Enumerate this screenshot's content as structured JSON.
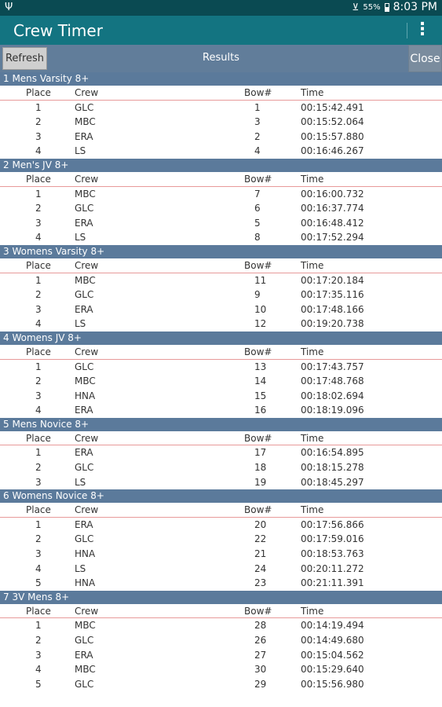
{
  "status_bar": {
    "battery_pct": "55%",
    "time": "8:03 PM"
  },
  "action_bar": {
    "title": "Crew Timer"
  },
  "toolbar": {
    "refresh_label": "Refresh",
    "heading": "Results",
    "close_label": "Close"
  },
  "columns": {
    "place": "Place",
    "crew": "Crew",
    "bow": "Bow#",
    "time": "Time"
  },
  "events": [
    {
      "name": "1 Mens Varsity 8+",
      "rows": [
        {
          "place": "1",
          "crew": "GLC",
          "bow": "1",
          "time": "00:15:42.491"
        },
        {
          "place": "2",
          "crew": "MBC",
          "bow": "3",
          "time": "00:15:52.064"
        },
        {
          "place": "3",
          "crew": "ERA",
          "bow": "2",
          "time": "00:15:57.880"
        },
        {
          "place": "4",
          "crew": "LS",
          "bow": "4",
          "time": "00:16:46.267"
        }
      ]
    },
    {
      "name": "2 Men's JV 8+",
      "rows": [
        {
          "place": "1",
          "crew": "MBC",
          "bow": "7",
          "time": "00:16:00.732"
        },
        {
          "place": "2",
          "crew": "GLC",
          "bow": "6",
          "time": "00:16:37.774"
        },
        {
          "place": "3",
          "crew": "ERA",
          "bow": "5",
          "time": "00:16:48.412"
        },
        {
          "place": "4",
          "crew": "LS",
          "bow": "8",
          "time": "00:17:52.294"
        }
      ]
    },
    {
      "name": "3 Womens Varsity 8+",
      "rows": [
        {
          "place": "1",
          "crew": "MBC",
          "bow": "11",
          "time": "00:17:20.184"
        },
        {
          "place": "2",
          "crew": "GLC",
          "bow": "9",
          "time": "00:17:35.116"
        },
        {
          "place": "3",
          "crew": "ERA",
          "bow": "10",
          "time": "00:17:48.166"
        },
        {
          "place": "4",
          "crew": "LS",
          "bow": "12",
          "time": "00:19:20.738"
        }
      ]
    },
    {
      "name": "4 Womens JV 8+",
      "rows": [
        {
          "place": "1",
          "crew": "GLC",
          "bow": "13",
          "time": "00:17:43.757"
        },
        {
          "place": "2",
          "crew": "MBC",
          "bow": "14",
          "time": "00:17:48.768"
        },
        {
          "place": "3",
          "crew": "HNA",
          "bow": "15",
          "time": "00:18:02.694"
        },
        {
          "place": "4",
          "crew": "ERA",
          "bow": "16",
          "time": "00:18:19.096"
        }
      ]
    },
    {
      "name": "5 Mens Novice 8+",
      "rows": [
        {
          "place": "1",
          "crew": "ERA",
          "bow": "17",
          "time": "00:16:54.895"
        },
        {
          "place": "2",
          "crew": "GLC",
          "bow": "18",
          "time": "00:18:15.278"
        },
        {
          "place": "3",
          "crew": "LS",
          "bow": "19",
          "time": "00:18:45.297"
        }
      ]
    },
    {
      "name": "6 Womens Novice 8+",
      "rows": [
        {
          "place": "1",
          "crew": "ERA",
          "bow": "20",
          "time": "00:17:56.866"
        },
        {
          "place": "2",
          "crew": "GLC",
          "bow": "22",
          "time": "00:17:59.016"
        },
        {
          "place": "3",
          "crew": "HNA",
          "bow": "21",
          "time": "00:18:53.763"
        },
        {
          "place": "4",
          "crew": "LS",
          "bow": "24",
          "time": "00:20:11.272"
        },
        {
          "place": "5",
          "crew": "HNA",
          "bow": "23",
          "time": "00:21:11.391"
        }
      ]
    },
    {
      "name": "7 3V Mens 8+",
      "rows": [
        {
          "place": "1",
          "crew": "MBC",
          "bow": "28",
          "time": "00:14:19.494"
        },
        {
          "place": "2",
          "crew": "GLC",
          "bow": "26",
          "time": "00:14:49.680"
        },
        {
          "place": "3",
          "crew": "ERA",
          "bow": "27",
          "time": "00:15:04.562"
        },
        {
          "place": "4",
          "crew": "MBC",
          "bow": "30",
          "time": "00:15:29.640"
        },
        {
          "place": "5",
          "crew": "GLC",
          "bow": "29",
          "time": "00:15:56.980"
        }
      ]
    }
  ]
}
